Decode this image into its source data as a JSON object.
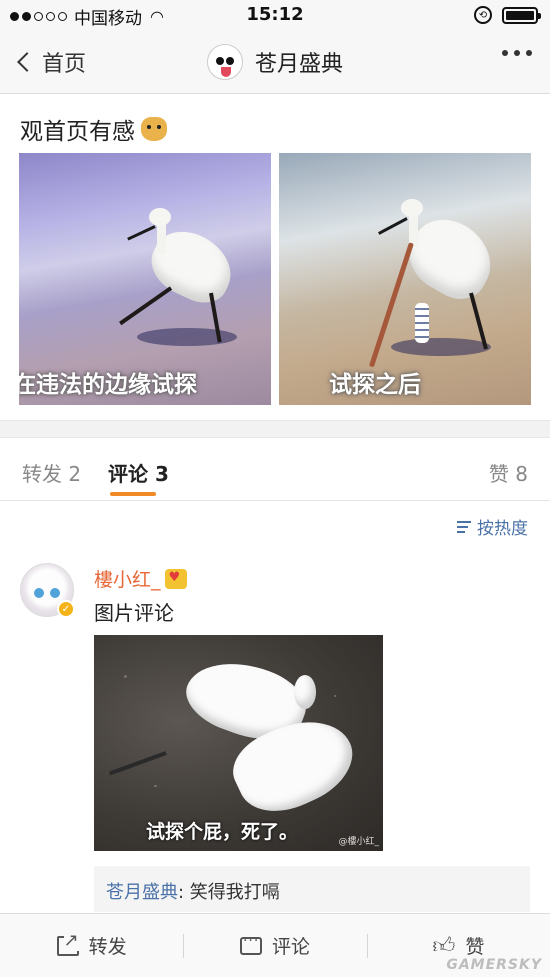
{
  "status_bar": {
    "carrier": "中国移动",
    "time": "15:12"
  },
  "nav": {
    "back_label": "首页",
    "title": "苍月盛典"
  },
  "post": {
    "text": "观首页有感",
    "images": [
      {
        "caption": "在违法的边缘试探"
      },
      {
        "caption": "试探之后"
      }
    ]
  },
  "tabs": {
    "repost": "转发 2",
    "comment": "评论 3",
    "like": "赞 8"
  },
  "sort_label": "按热度",
  "comment": {
    "username": "樓小红_",
    "text": "图片评论",
    "image_caption": "试探个屁，死了。",
    "image_watermark": "@樓小红_",
    "reply": {
      "author": "苍月盛典",
      "text": ": 笑得我打嗝"
    }
  },
  "bottom_bar": {
    "repost": "转发",
    "comment": "评论",
    "like": "赞"
  },
  "watermark": "GAMERSKY",
  "colors": {
    "accent": "#f08a24",
    "link": "#4b72a8",
    "username": "#e8683a"
  }
}
